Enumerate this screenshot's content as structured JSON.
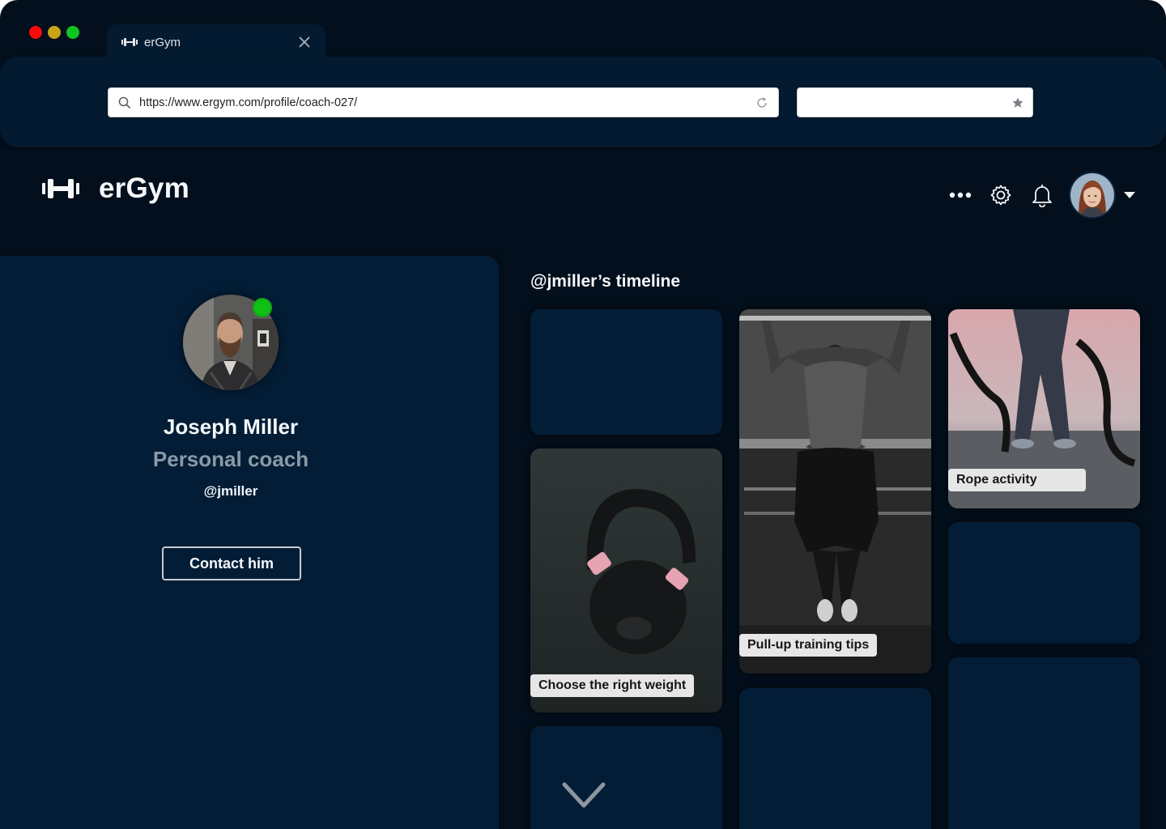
{
  "browser": {
    "tab_title": "erGym",
    "url": "https://www.ergym.com/profile/coach-027/",
    "search_value": ""
  },
  "app": {
    "brand": "erGym"
  },
  "header": {
    "icons": [
      "more-icon",
      "gear-icon",
      "bell-icon",
      "user-avatar",
      "chevron-down-icon"
    ]
  },
  "profile": {
    "name": "Joseph Miller",
    "role": "Personal coach",
    "handle": "@jmiller",
    "status": "online",
    "contact_label": "Contact him"
  },
  "timeline": {
    "title": "@jmiller’s timeline",
    "posts": [
      {
        "caption": "Choose the right weight"
      },
      {
        "caption": "Pull-up training tips"
      },
      {
        "caption": "Rope activity"
      }
    ]
  },
  "colors": {
    "background": "#030f1c",
    "panel": "#031d36",
    "toolbar": "#041a30",
    "online": "#10c013",
    "caption_bg": "#e6e6e6"
  }
}
